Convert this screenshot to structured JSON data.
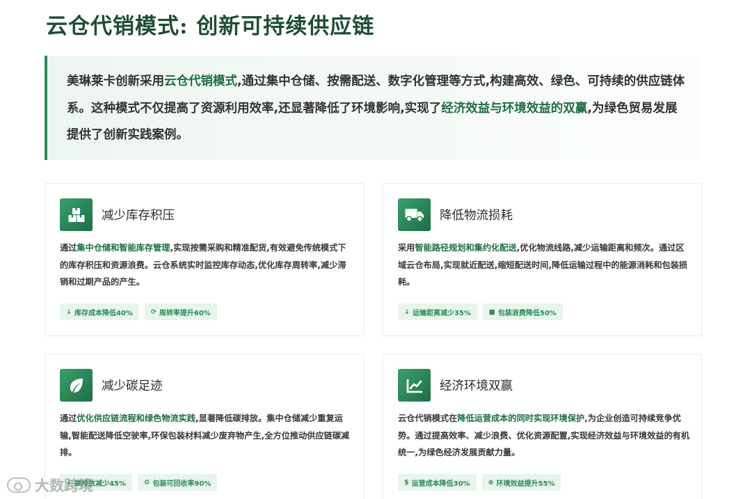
{
  "page_title": "云仓代销模式: 创新可持续供应链",
  "intro": {
    "t1": "美琳莱卡创新采用",
    "h1": "云仓代销模式",
    "t2": ",通过集中仓储、按需配送、数字化管理等方式,构建高效、绿色、可持续的供应链体系。这种模式不仅提高了资源利用效率,还显著降低了环境影响,实现了",
    "h2": "经济效益与环境效益的双赢",
    "t3": ",为绿色贸易发展提供了创新实践案例。"
  },
  "cards": [
    {
      "icon": "boxes-icon",
      "title": "减少库存积压",
      "b1": "通过",
      "h1": "集中仓储和智能库存管理",
      "b2": ",实现按需采购和精准配货,有效避免传统模式下的库存积压和资源浪费。云仓系统实时监控库存动态,优化库存周转率,减少滞销和过期产品的产生。",
      "tags": [
        {
          "icon": "arrow-down-icon",
          "glyph": "↓",
          "label": "库存成本降低40%"
        },
        {
          "icon": "sync-icon",
          "glyph": "⟳",
          "label": "周转率提升60%"
        }
      ]
    },
    {
      "icon": "truck-icon",
      "title": "降低物流损耗",
      "b1": "采用",
      "h1": "智能路径规划和集约化配送",
      "b2": ",优化物流线路,减少运输距离和频次。通过区域云仓布局,实现就近配送,缩短配送时间,降低运输过程中的能源消耗和包装损耗。",
      "tags": [
        {
          "icon": "arrow-down-icon",
          "glyph": "↓",
          "label": "运输距离减少35%"
        },
        {
          "icon": "box-icon",
          "glyph": "■",
          "label": "包装浪费降低50%"
        }
      ]
    },
    {
      "icon": "leaf-icon",
      "title": "减少碳足迹",
      "b1": "通过",
      "h1": "优化供应链流程和绿色物流实践",
      "b2": ",显著降低碳排放。集中仓储减少重复运输,智能配送降低空驶率,环保包装材料减少废弃物产生,全方位推动供应链碳减排。",
      "tags": [
        {
          "icon": "arrow-down-icon",
          "glyph": "↓",
          "label": "碳排放减少45%"
        },
        {
          "icon": "recycle-icon",
          "glyph": "♻",
          "label": "包装可回收率90%"
        }
      ]
    },
    {
      "icon": "chart-line-icon",
      "title": "经济环境双赢",
      "b1": "云仓代销模式在",
      "h1": "降低运营成本的同时实现环境保护",
      "b2": ",为企业创造可持续竞争优势。通过提高效率、减少浪费、优化资源配置,实现经济效益与环境效益的有机统一,为绿色经济发展贡献力量。",
      "tags": [
        {
          "icon": "dollar-icon",
          "glyph": "$",
          "label": "运营成本降低30%"
        },
        {
          "icon": "globe-icon",
          "glyph": "⊕",
          "label": "环境效益提升55%"
        }
      ]
    }
  ],
  "watermark": "大数跨境"
}
